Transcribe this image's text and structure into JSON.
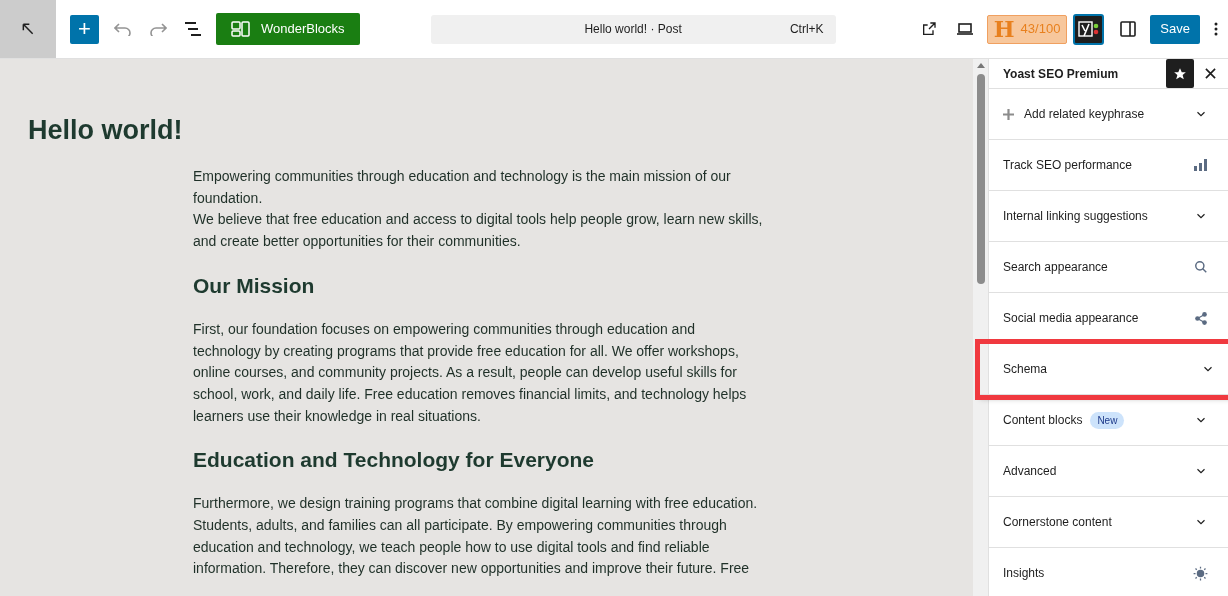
{
  "toolbar": {
    "add_label": "+",
    "wonderblocks": "WonderBlocks",
    "command_bar": {
      "title": "Hello world! · Post",
      "shortcut": "Ctrl+K"
    },
    "score": {
      "letter": "H",
      "value": "43/100"
    },
    "save": "Save"
  },
  "editor": {
    "title": "Hello world!",
    "blocks": [
      {
        "kind": "paragraph",
        "text": "Empowering communities through education and technology is the main mission of our foundation."
      },
      {
        "kind": "paragraph",
        "text": "We believe that free education and access to digital tools help people grow, learn new skills, and create better opportunities for their communities."
      },
      {
        "kind": "heading",
        "text": "Our Mission"
      },
      {
        "kind": "paragraph",
        "text": "First, our foundation focuses on empowering communities through education and technology by creating programs that provide free education for all. We offer workshops, online courses, and community projects. As a result, people can develop useful skills for school, work, and daily life. Free education removes financial limits, and technology helps learners use their knowledge in real situations."
      },
      {
        "kind": "heading",
        "text": "Education and Technology for Everyone"
      },
      {
        "kind": "paragraph",
        "text": "Furthermore, we design training programs that combine digital learning with free education. Students, adults, and families can all participate. By empowering communities through education and technology, we teach people how to use digital tools and find reliable information. Therefore, they can discover new opportunities and improve their future. Free"
      }
    ]
  },
  "sidebar": {
    "title": "Yoast SEO Premium",
    "items": [
      {
        "label": "Add related keyphrase",
        "kind": "add",
        "highlighted": false
      },
      {
        "label": "Track SEO performance",
        "kind": "link",
        "highlighted": false
      },
      {
        "label": "Internal linking suggestions",
        "kind": "expand",
        "highlighted": false
      },
      {
        "label": "Search appearance",
        "kind": "search",
        "highlighted": false
      },
      {
        "label": "Social media appearance",
        "kind": "social",
        "highlighted": false
      },
      {
        "label": "Schema",
        "kind": "expand",
        "highlighted": true
      },
      {
        "label": "Content blocks",
        "badge": "New",
        "kind": "expand",
        "highlighted": false
      },
      {
        "label": "Advanced",
        "kind": "expand",
        "highlighted": false
      },
      {
        "label": "Cornerstone content",
        "kind": "expand",
        "highlighted": false
      },
      {
        "label": "Insights",
        "kind": "insights",
        "highlighted": false
      }
    ]
  }
}
